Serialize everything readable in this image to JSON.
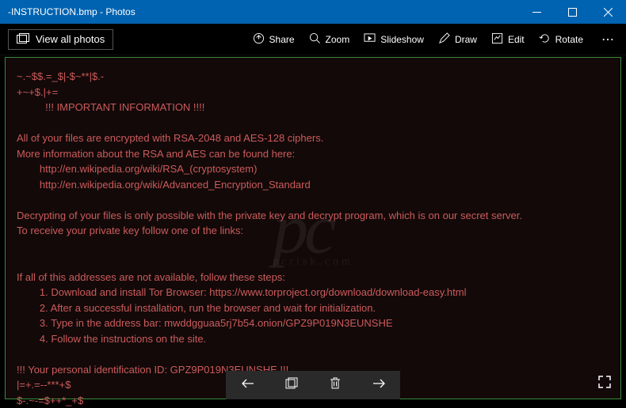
{
  "window": {
    "title": "-INSTRUCTION.bmp - Photos"
  },
  "toolbar": {
    "view_all": "View all photos",
    "share": "Share",
    "zoom": "Zoom",
    "slideshow": "Slideshow",
    "draw": "Draw",
    "edit": "Edit",
    "rotate": "Rotate"
  },
  "ransom": {
    "line1": "~.~$$.=_$|-$~**|$.-",
    "line2": "+~+$.|+=",
    "header": "          !!! IMPORTANT INFORMATION !!!!",
    "blank1": "",
    "p1a": "All of your files are encrypted with RSA-2048 and AES-128 ciphers.",
    "p1b": "More information about the RSA and AES can be found here:",
    "p1c": "        http://en.wikipedia.org/wiki/RSA_(cryptosystem)",
    "p1d": "        http://en.wikipedia.org/wiki/Advanced_Encryption_Standard",
    "blank2": "",
    "p2a": "Decrypting of your files is only possible with the private key and decrypt program, which is on our secret server.",
    "p2b": "To receive your private key follow one of the links:",
    "blank3": "",
    "blank4": "",
    "p3a": "If all of this addresses are not available, follow these steps:",
    "p3b": "        1. Download and install Tor Browser: https://www.torproject.org/download/download-easy.html",
    "p3c": "        2. After a successful installation, run the browser and wait for initialization.",
    "p3d": "        3. Type in the address bar: mwddgguaa5rj7b54.onion/GPZ9P019N3EUNSHE",
    "p3e": "        4. Follow the instructions on the site.",
    "blank5": "",
    "p4a": "!!! Your personal identification ID: GPZ9P019N3EUNSHE !!!",
    "p4b": "|=+.=--***+$",
    "p4c": "$-.~-=$++*_+$"
  },
  "watermark": {
    "main": "pc",
    "sub": "pcrisk.com"
  }
}
